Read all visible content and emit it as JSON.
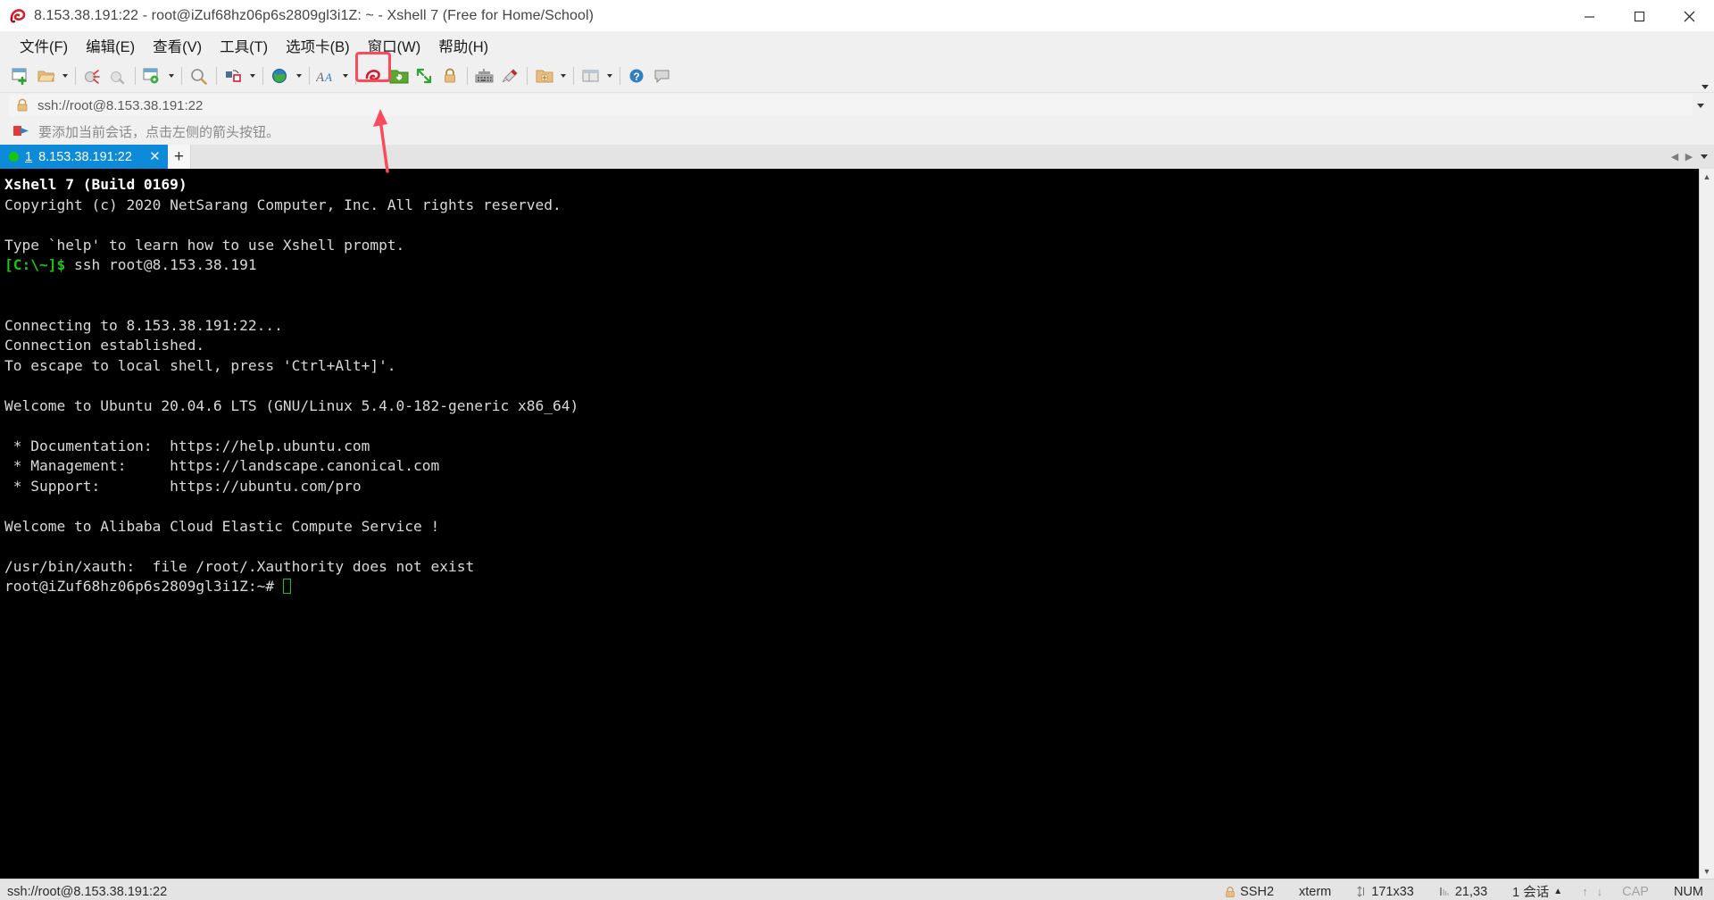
{
  "window": {
    "title": "8.153.38.191:22 - root@iZuf68hz06p6s2809gl3i1Z: ~ - Xshell 7 (Free for Home/School)",
    "app_icon": "xshell-shell-icon",
    "minimize": "minimize-icon",
    "maximize": "maximize-icon",
    "close": "close-icon"
  },
  "menubar": {
    "items": [
      {
        "label": "文件(F)",
        "name": "menu-file"
      },
      {
        "label": "编辑(E)",
        "name": "menu-edit"
      },
      {
        "label": "查看(V)",
        "name": "menu-view"
      },
      {
        "label": "工具(T)",
        "name": "menu-tools"
      },
      {
        "label": "选项卡(B)",
        "name": "menu-tabs"
      },
      {
        "label": "窗口(W)",
        "name": "menu-window"
      },
      {
        "label": "帮助(H)",
        "name": "menu-help"
      }
    ]
  },
  "toolbar": {
    "highlight_color": "#fb4a5c",
    "annotation_arrow_color": "#fb4a5c",
    "buttons": [
      {
        "name": "new-session-icon",
        "tooltip": "新建会话"
      },
      {
        "name": "open-folder-icon",
        "tooltip": "打开"
      },
      {
        "name": "disconnect-icon",
        "tooltip": "断开"
      },
      {
        "name": "reconnect-icon",
        "tooltip": "重新连接"
      },
      {
        "name": "session-properties-icon",
        "tooltip": "属性"
      },
      {
        "name": "find-icon",
        "tooltip": "查找"
      },
      {
        "name": "transfer-file-icon",
        "tooltip": "传输文件"
      },
      {
        "name": "globe-icon",
        "tooltip": "浏览器"
      },
      {
        "name": "font-size-icon",
        "tooltip": "字体"
      },
      {
        "name": "xshell-red-icon",
        "tooltip": "Xshell"
      },
      {
        "name": "xftp-green-icon",
        "tooltip": "新建 Xftp 文件传输"
      },
      {
        "name": "fullscreen-icon",
        "tooltip": "全屏"
      },
      {
        "name": "lock-icon",
        "tooltip": "锁定"
      },
      {
        "name": "keyboard-icon",
        "tooltip": "键盘"
      },
      {
        "name": "highlight-pen-icon",
        "tooltip": "高亮"
      },
      {
        "name": "add-folder-icon",
        "tooltip": "添加文件夹"
      },
      {
        "name": "layout-icon",
        "tooltip": "布局"
      },
      {
        "name": "help-icon",
        "tooltip": "帮助"
      },
      {
        "name": "chat-icon",
        "tooltip": "聊天"
      }
    ]
  },
  "addressbar": {
    "lock_icon": "lock-icon",
    "value": "ssh://root@8.153.38.191:22",
    "placeholder": "ssh://"
  },
  "notification": {
    "icon": "arrow-flag-icon",
    "text": "要添加当前会话，点击左侧的箭头按钮。"
  },
  "tabs": {
    "items": [
      {
        "status_color": "#16c60c",
        "number": "1",
        "label": "8.153.38.191:22",
        "close_label": "✕",
        "active": true
      }
    ],
    "add_label": "+",
    "nav_prev": "◀",
    "nav_next": "▶"
  },
  "terminal": {
    "lines": [
      {
        "segments": [
          {
            "text": "Xshell 7 (Build 0169)",
            "style": "bold"
          }
        ]
      },
      {
        "segments": [
          {
            "text": "Copyright (c) 2020 NetSarang Computer, Inc. All rights reserved.",
            "style": "normal"
          }
        ]
      },
      {
        "segments": [
          {
            "text": "",
            "style": "normal"
          }
        ]
      },
      {
        "segments": [
          {
            "text": "Type `help' to learn how to use Xshell prompt.",
            "style": "normal"
          }
        ]
      },
      {
        "segments": [
          {
            "text": "[C:\\~]$ ",
            "style": "green-bold"
          },
          {
            "text": "ssh root@8.153.38.191",
            "style": "normal"
          }
        ]
      },
      {
        "segments": [
          {
            "text": "",
            "style": "normal"
          }
        ]
      },
      {
        "segments": [
          {
            "text": "",
            "style": "normal"
          }
        ]
      },
      {
        "segments": [
          {
            "text": "Connecting to 8.153.38.191:22...",
            "style": "normal"
          }
        ]
      },
      {
        "segments": [
          {
            "text": "Connection established.",
            "style": "normal"
          }
        ]
      },
      {
        "segments": [
          {
            "text": "To escape to local shell, press 'Ctrl+Alt+]'.",
            "style": "normal"
          }
        ]
      },
      {
        "segments": [
          {
            "text": "",
            "style": "normal"
          }
        ]
      },
      {
        "segments": [
          {
            "text": "Welcome to Ubuntu 20.04.6 LTS (GNU/Linux 5.4.0-182-generic x86_64)",
            "style": "normal"
          }
        ]
      },
      {
        "segments": [
          {
            "text": "",
            "style": "normal"
          }
        ]
      },
      {
        "segments": [
          {
            "text": " * Documentation:  https://help.ubuntu.com",
            "style": "normal"
          }
        ]
      },
      {
        "segments": [
          {
            "text": " * Management:     https://landscape.canonical.com",
            "style": "normal"
          }
        ]
      },
      {
        "segments": [
          {
            "text": " * Support:        https://ubuntu.com/pro",
            "style": "normal"
          }
        ]
      },
      {
        "segments": [
          {
            "text": "",
            "style": "normal"
          }
        ]
      },
      {
        "segments": [
          {
            "text": "Welcome to Alibaba Cloud Elastic Compute Service !",
            "style": "normal"
          }
        ]
      },
      {
        "segments": [
          {
            "text": "",
            "style": "normal"
          }
        ]
      },
      {
        "segments": [
          {
            "text": "/usr/bin/xauth:  file /root/.Xauthority does not exist",
            "style": "normal"
          }
        ]
      },
      {
        "segments": [
          {
            "text": "root@iZuf68hz06p6s2809gl3i1Z:~# ",
            "style": "normal"
          },
          {
            "text": "",
            "style": "cursor"
          }
        ]
      }
    ],
    "background": "#000000",
    "foreground": "#d9d9d9",
    "prompt_color": "#16c60c",
    "cursor_color": "#16c60c"
  },
  "statusbar": {
    "connection": "ssh://root@8.153.38.191:22",
    "protocol_icon": "lock-icon",
    "protocol": "SSH2",
    "term_type": "xterm",
    "size_icon": "resize-icon",
    "size": "171x33",
    "position_icon": "cursor-pos-icon",
    "position": "21,33",
    "sessions": "1 会话",
    "sessions_caret": "▲",
    "up_arrow": "↑",
    "down_arrow": "↓",
    "cap": "CAP",
    "num": "NUM"
  }
}
